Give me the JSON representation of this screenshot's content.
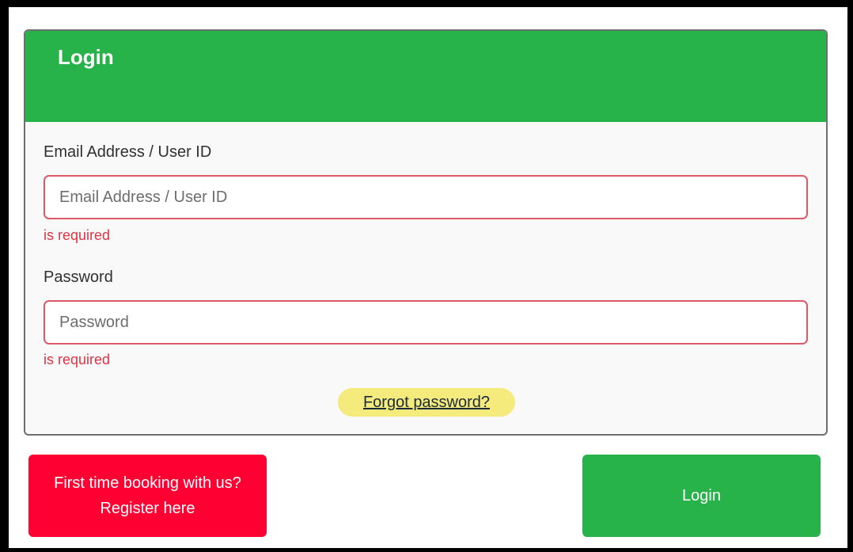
{
  "login_card": {
    "title": "Login",
    "email_field": {
      "label": "Email Address / User ID",
      "placeholder": "Email Address / User ID",
      "value": "",
      "error": "is required"
    },
    "password_field": {
      "label": "Password",
      "placeholder": "Password",
      "value": "",
      "error": "is required"
    },
    "forgot_password_label": "Forgot password?"
  },
  "actions": {
    "register_label": "First time booking with us? Register here",
    "login_label": "Login"
  },
  "colors": {
    "header_green": "#27b24a",
    "register_red": "#ff0033",
    "error_red": "#dc3545",
    "highlight_yellow": "#f5ea7c"
  }
}
